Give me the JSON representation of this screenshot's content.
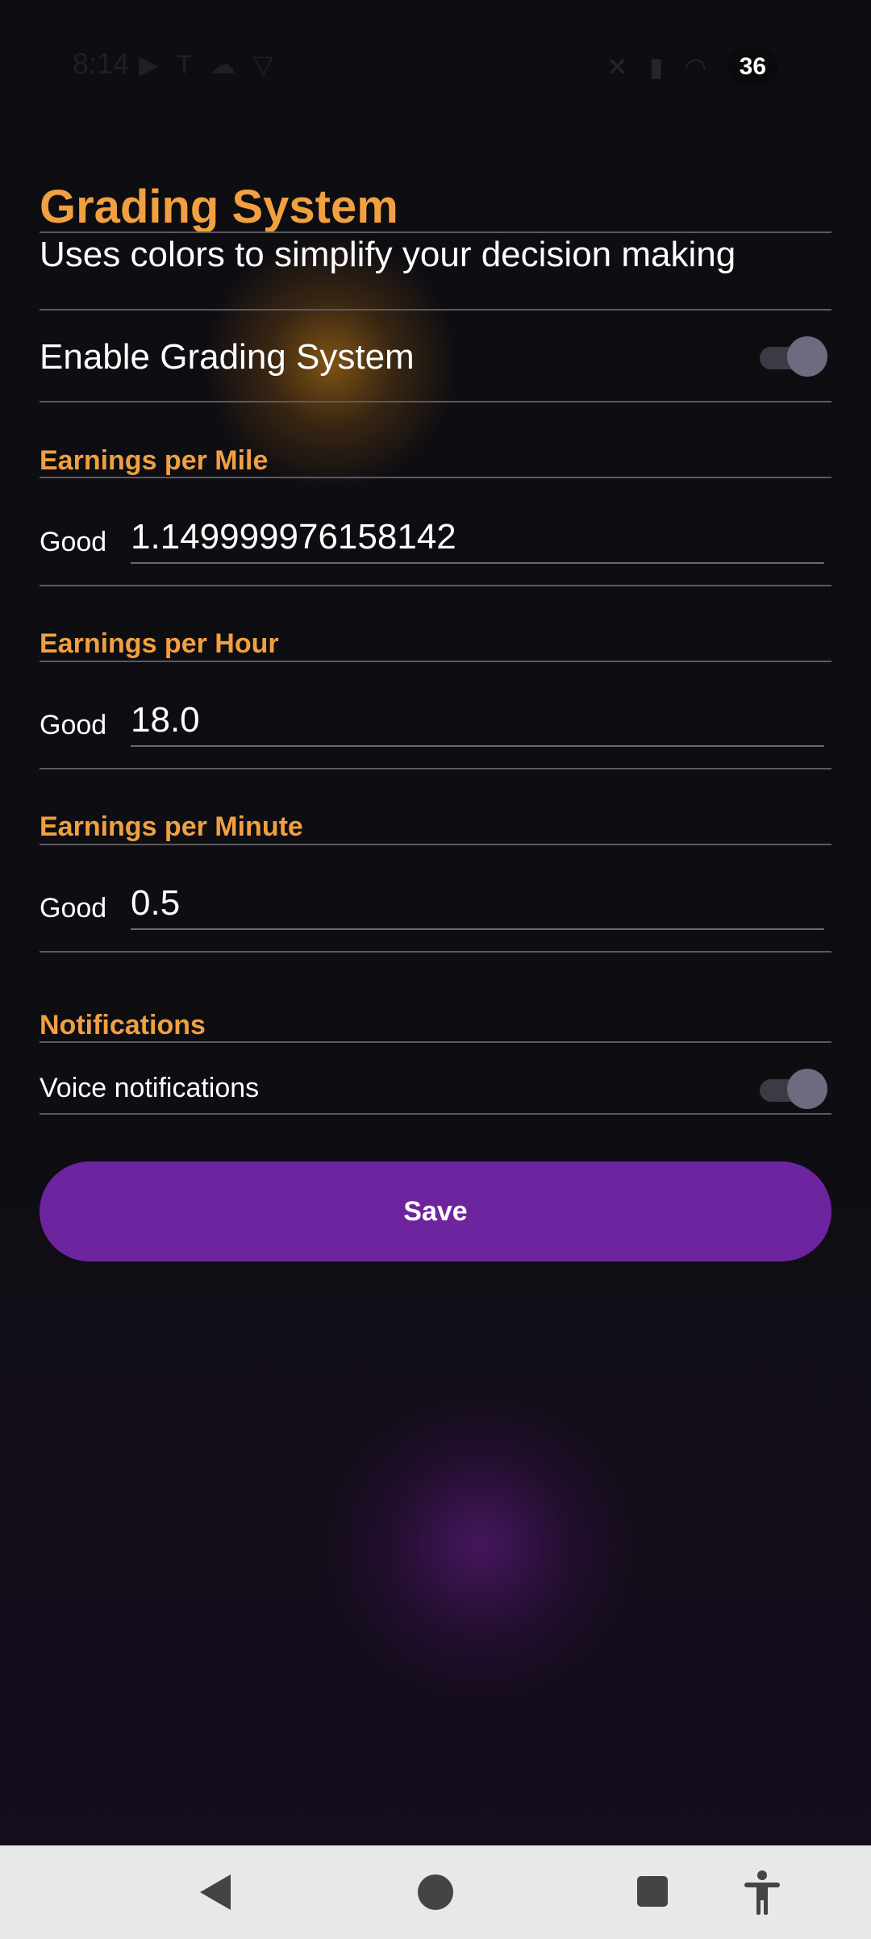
{
  "status_bar": {
    "time": "8:14",
    "left_icons": [
      "youtube-icon",
      "tesla-icon",
      "cloud-icon",
      "vpn-icon"
    ],
    "right_icons": [
      "mute-icon",
      "signal-icon",
      "wifi-icon"
    ],
    "battery": "36"
  },
  "header": {
    "title": "Grading System",
    "subtitle": "Uses colors to simplify your decision making"
  },
  "grading_toggle": {
    "label": "Enable Grading System",
    "enabled": true
  },
  "sections": [
    {
      "heading": "Earnings per Mile",
      "grade_label": "Good",
      "value": "1.149999976158142"
    },
    {
      "heading": "Earnings per Hour",
      "grade_label": "Good",
      "value": "18.0"
    },
    {
      "heading": "Earnings per Minute",
      "grade_label": "Good",
      "value": "0.5"
    }
  ],
  "notifications": {
    "heading": "Notifications",
    "voice_label": "Voice notifications",
    "voice_enabled": true
  },
  "save_button": {
    "label": "Save"
  },
  "colors": {
    "accent_orange": "#f0a040",
    "button_purple": "#6d259f",
    "background": "#0e0d12"
  },
  "nav_bar": {
    "icons": [
      "back-icon",
      "home-icon",
      "recents-icon",
      "accessibility-icon"
    ]
  }
}
